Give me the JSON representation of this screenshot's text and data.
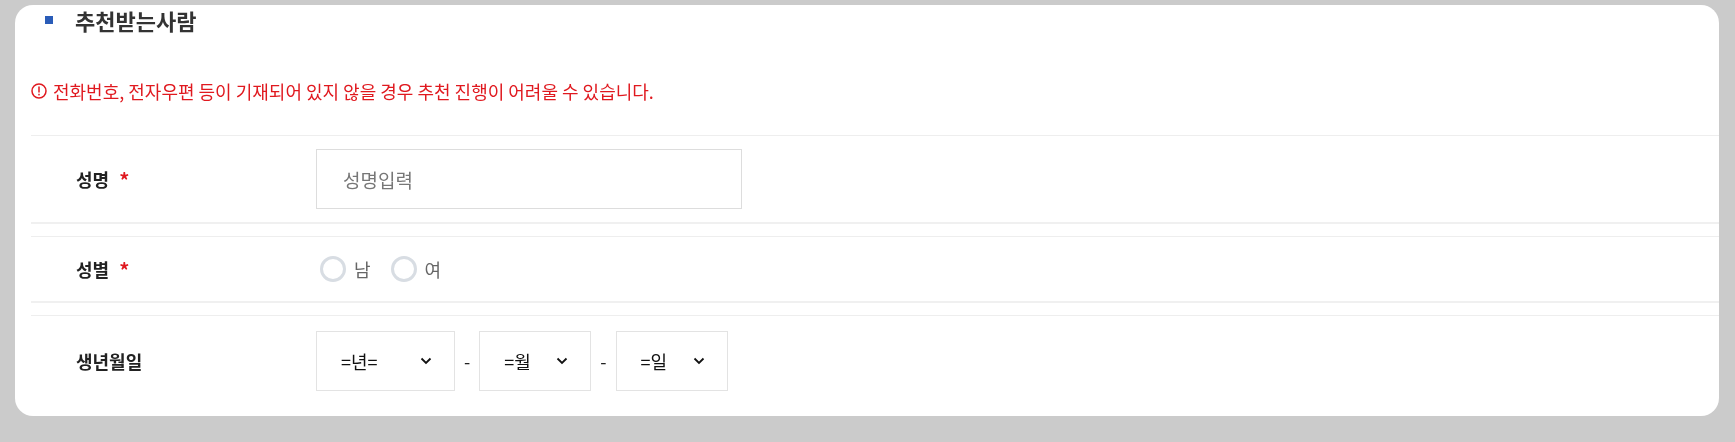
{
  "section": {
    "title": "추천받는사람",
    "notice": "전화번호, 전자우편 등이 기재되어 있지 않을 경우 추천 진행이 어려울 수 있습니다."
  },
  "fields": [
    {
      "kind": "text",
      "label": "성명",
      "marker": "*",
      "placeholder": "성명입력"
    },
    {
      "kind": "radio",
      "label": "성별",
      "marker": "*",
      "options": [
        {
          "label": "남",
          "selected": false
        },
        {
          "label": "여",
          "selected": false
        }
      ]
    },
    {
      "kind": "date",
      "label": "생년월일",
      "selects": [
        {
          "value": "=년="
        },
        {
          "value": "=월"
        },
        {
          "value": "=일"
        }
      ],
      "separators": [
        "-",
        "-"
      ]
    }
  ]
}
